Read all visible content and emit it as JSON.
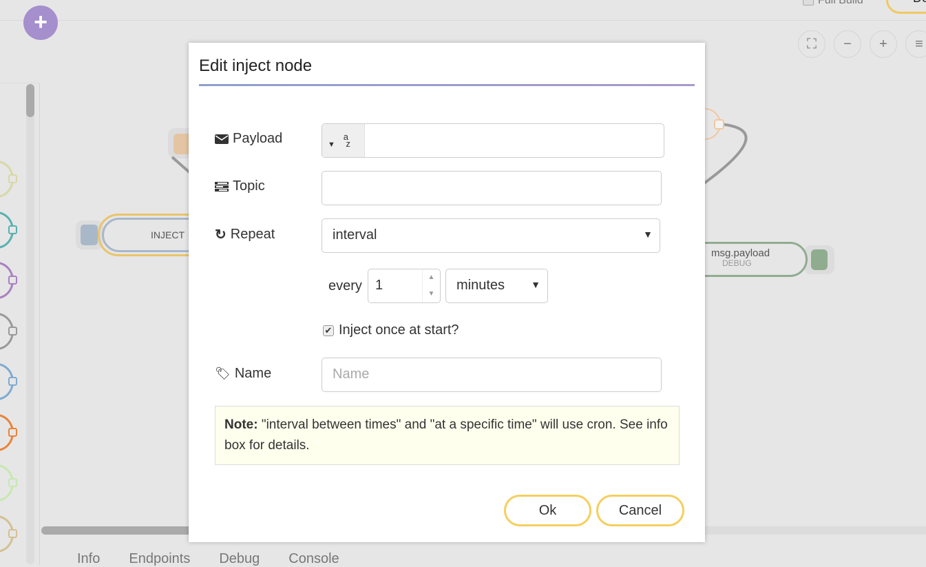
{
  "header": {
    "full_build_label": "Full Build",
    "deploy_label": "De",
    "add_icon": "plus-icon"
  },
  "zoom_controls": [
    "fit-icon",
    "zoom-out-icon",
    "zoom-in-icon",
    "menu-icon"
  ],
  "bottom_tabs": [
    "Info",
    "Endpoints",
    "Debug",
    "Console"
  ],
  "canvas": {
    "inject_node_label": "INJECT",
    "debug_node_label": "msg.payload",
    "debug_node_type": "DEBUG"
  },
  "palette_colors": [
    "#d8d8a8",
    "#5ab0b0",
    "#a880c0",
    "#999999",
    "#80aad0",
    "#e8843a",
    "#c8e8b0",
    "#d4c094"
  ],
  "dialog": {
    "title": "Edit inject node",
    "payload_label": "Payload",
    "payload_type": "az",
    "payload_value": "",
    "topic_label": "Topic",
    "topic_value": "",
    "repeat_label": "Repeat",
    "repeat_value": "interval",
    "every_label": "every",
    "every_value": "1",
    "every_unit": "minutes",
    "inject_once_label": "Inject once at start?",
    "inject_once_checked": true,
    "name_label": "Name",
    "name_placeholder": "Name",
    "note_bold": "Note:",
    "note_text": " \"interval between times\" and \"at a specific time\" will use cron. See info box for details.",
    "ok_label": "Ok",
    "cancel_label": "Cancel"
  }
}
